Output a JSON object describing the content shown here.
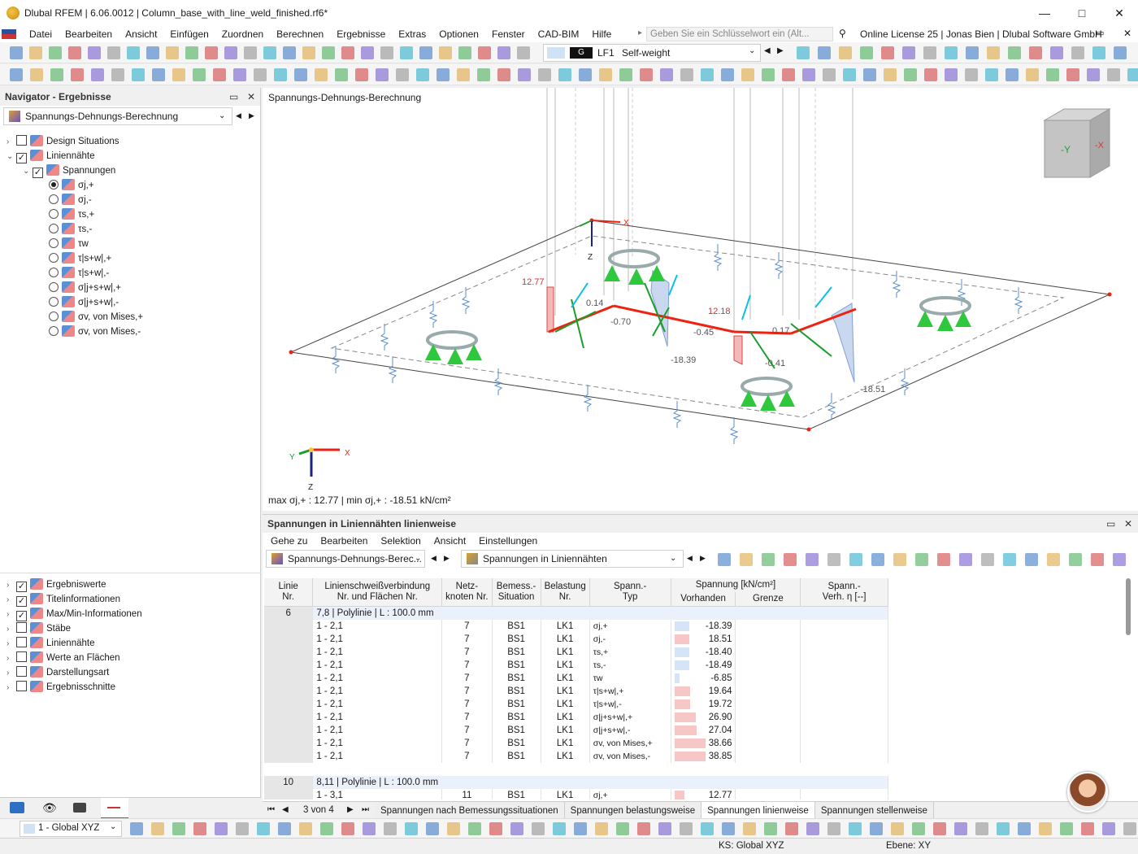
{
  "window": {
    "title": "Dlubal RFEM | 6.06.0012 | Column_base_with_line_weld_finished.rf6*"
  },
  "menu": [
    "Datei",
    "Bearbeiten",
    "Ansicht",
    "Einfügen",
    "Zuordnen",
    "Berechnen",
    "Ergebnisse",
    "Extras",
    "Optionen",
    "Fenster",
    "CAD-BIM",
    "Hilfe"
  ],
  "search": {
    "placeholder": "Geben Sie ein Schlüsselwort ein (Alt..."
  },
  "license": "Online License 25 | Jonas Bien | Dlubal Software GmbH",
  "loadcase": {
    "code": "G",
    "id": "LF1",
    "name": "Self-weight"
  },
  "navigator": {
    "title": "Navigator - Ergebnisse",
    "combo": "Spannungs-Dehnungs-Berechnung",
    "tree": [
      {
        "label": "Design Situations",
        "level": 0,
        "type": "check",
        "checked": false
      },
      {
        "label": "Liniennähte",
        "level": 0,
        "type": "check",
        "checked": true,
        "expanded": true
      },
      {
        "label": "Spannungen",
        "level": 1,
        "type": "check",
        "checked": true,
        "expanded": true
      },
      {
        "label": "σj,+",
        "level": 2,
        "type": "radio",
        "checked": true
      },
      {
        "label": "σj,-",
        "level": 2,
        "type": "radio",
        "checked": false
      },
      {
        "label": "τs,+",
        "level": 2,
        "type": "radio",
        "checked": false
      },
      {
        "label": "τs,-",
        "level": 2,
        "type": "radio",
        "checked": false
      },
      {
        "label": "τw",
        "level": 2,
        "type": "radio",
        "checked": false
      },
      {
        "label": "τ|s+w|,+",
        "level": 2,
        "type": "radio",
        "checked": false
      },
      {
        "label": "τ|s+w|,-",
        "level": 2,
        "type": "radio",
        "checked": false
      },
      {
        "label": "σ|j+s+w|,+",
        "level": 2,
        "type": "radio",
        "checked": false
      },
      {
        "label": "σ|j+s+w|,-",
        "level": 2,
        "type": "radio",
        "checked": false
      },
      {
        "label": "σv, von Mises,+",
        "level": 2,
        "type": "radio",
        "checked": false
      },
      {
        "label": "σv, von Mises,-",
        "level": 2,
        "type": "radio",
        "checked": false
      }
    ],
    "tree2": [
      {
        "label": "Ergebniswerte",
        "checked": true
      },
      {
        "label": "Titelinformationen",
        "checked": true
      },
      {
        "label": "Max/Min-Informationen",
        "checked": true
      },
      {
        "label": "Stäbe",
        "checked": false
      },
      {
        "label": "Liniennähte",
        "checked": false
      },
      {
        "label": "Werte an Flächen",
        "checked": false
      },
      {
        "label": "Darstellungsart",
        "checked": false
      },
      {
        "label": "Ergebnisschnitte",
        "checked": false
      }
    ]
  },
  "view": {
    "title": "Spannungs-Dehnungs-Berechnung",
    "maxmin": "max σj,+ : 12.77 | min σj,+ : -18.51 kN/cm²",
    "labels": {
      "v1": "12.77",
      "v2": "-0.70",
      "v3": "-18.39",
      "v4": "12.18",
      "v5": "-0.45",
      "v6": "-0.41",
      "v7": "-18.51",
      "v8": "0.14",
      "v9": "0.17"
    },
    "axes": {
      "x": "X",
      "y": "Y",
      "z": "Z"
    },
    "cube": {
      "front": "-Y",
      "side": "-X"
    }
  },
  "results": {
    "title": "Spannungen in Liniennähten linienweise",
    "menu": [
      "Gehe zu",
      "Bearbeiten",
      "Selektion",
      "Ansicht",
      "Einstellungen"
    ],
    "combo1": "Spannungs-Dehnungs-Berec...",
    "combo2": "Spannungen in Liniennähten",
    "headers": {
      "linie": "Linie\nNr.",
      "verbindung": "Linienschweißverbindung\nNr. und Flächen Nr.",
      "netz": "Netz-\nknoten Nr.",
      "bemess": "Bemess.-\nSituation",
      "belast": "Belastung\nNr.",
      "typ": "Spann.-\nTyp",
      "spannung": "Spannung [kN/cm²]",
      "vorhanden": "Vorhanden",
      "grenze": "Grenze",
      "verh": "Spann.-\nVerh. η [--]"
    },
    "group1": {
      "linie": "6",
      "desc": "7,8 | Polylinie | L : 100.0 mm"
    },
    "rows1": [
      {
        "v": "1 - 2,1",
        "n": "7",
        "b": "BS1",
        "l": "LK1",
        "t": "σj,+",
        "val": "-18.39",
        "f": -18.39
      },
      {
        "v": "1 - 2,1",
        "n": "7",
        "b": "BS1",
        "l": "LK1",
        "t": "σj,-",
        "val": "18.51",
        "f": 18.51
      },
      {
        "v": "1 - 2,1",
        "n": "7",
        "b": "BS1",
        "l": "LK1",
        "t": "τs,+",
        "val": "-18.40",
        "f": -18.4
      },
      {
        "v": "1 - 2,1",
        "n": "7",
        "b": "BS1",
        "l": "LK1",
        "t": "τs,-",
        "val": "-18.49",
        "f": -18.49
      },
      {
        "v": "1 - 2,1",
        "n": "7",
        "b": "BS1",
        "l": "LK1",
        "t": "τw",
        "val": "-6.85",
        "f": -6.85
      },
      {
        "v": "1 - 2,1",
        "n": "7",
        "b": "BS1",
        "l": "LK1",
        "t": "τ|s+w|,+",
        "val": "19.64",
        "f": 19.64
      },
      {
        "v": "1 - 2,1",
        "n": "7",
        "b": "BS1",
        "l": "LK1",
        "t": "τ|s+w|,-",
        "val": "19.72",
        "f": 19.72
      },
      {
        "v": "1 - 2,1",
        "n": "7",
        "b": "BS1",
        "l": "LK1",
        "t": "σ|j+s+w|,+",
        "val": "26.90",
        "f": 26.9
      },
      {
        "v": "1 - 2,1",
        "n": "7",
        "b": "BS1",
        "l": "LK1",
        "t": "σ|j+s+w|,-",
        "val": "27.04",
        "f": 27.04
      },
      {
        "v": "1 - 2,1",
        "n": "7",
        "b": "BS1",
        "l": "LK1",
        "t": "σv, von Mises,+",
        "val": "38.66",
        "f": 38.66
      },
      {
        "v": "1 - 2,1",
        "n": "7",
        "b": "BS1",
        "l": "LK1",
        "t": "σv, von Mises,-",
        "val": "38.85",
        "f": 38.85
      }
    ],
    "group2": {
      "linie": "10",
      "desc": "8,11 | Polylinie | L : 100.0 mm"
    },
    "rows2": [
      {
        "v": "1 - 3,1",
        "n": "11",
        "b": "BS1",
        "l": "LK1",
        "t": "σj,+",
        "val": "12.77",
        "f": 12.77
      }
    ],
    "pager": "3 von 4",
    "tabs": [
      "Spannungen nach Bemessungssituationen",
      "Spannungen belastungsweise",
      "Spannungen linienweise",
      "Spannungen stellenweise"
    ],
    "active_tab": 2
  },
  "bottombar": {
    "cs": "1 - Global XYZ"
  },
  "status": {
    "ks": "KS: Global XYZ",
    "ebene": "Ebene: XY"
  }
}
